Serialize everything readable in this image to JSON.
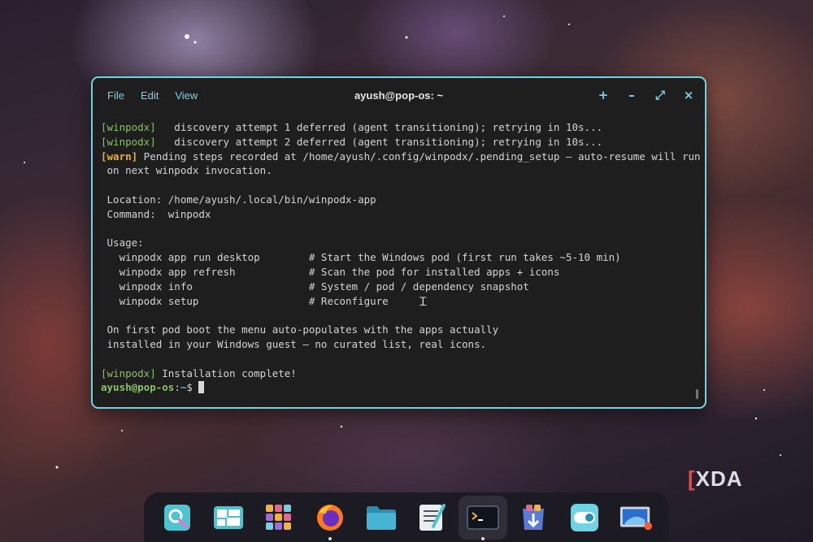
{
  "window": {
    "title": "ayush@pop-os: ~",
    "menu": [
      "File",
      "Edit",
      "View"
    ],
    "controls": {
      "new_tab": "+",
      "minimize": "–",
      "maximize": "⤢",
      "close": "×"
    }
  },
  "terminal": {
    "line1_tag": "[winpodx]",
    "line1_text": "   discovery attempt 1 deferred (agent transitioning); retrying in 10s...",
    "line2_tag": "[winpodx]",
    "line2_text": "   discovery attempt 2 deferred (agent transitioning); retrying in 10s...",
    "warn_tag": "[warn]",
    "warn_text": " Pending steps recorded at /home/ayush/.config/winpodx/.pending_setup — auto-resume will run",
    "warn_cont": " on next winpodx invocation.",
    "location": " Location: /home/ayush/.local/bin/winpodx-app",
    "command": " Command:  winpodx",
    "usage": " Usage:",
    "usage_rows": [
      "   winpodx app run desktop        # Start the Windows pod (first run takes ~5-10 min)",
      "   winpodx app refresh            # Scan the pod for installed apps + icons",
      "   winpodx info                   # System / pod / dependency snapshot",
      "   winpodx setup                  # Reconfigure"
    ],
    "note1": " On first pod boot the menu auto-populates with the apps actually",
    "note2": " installed in your Windows guest — no curated list, real icons.",
    "done_tag": "[winpodx]",
    "done_text": " Installation complete!",
    "prompt_user": "ayush@pop-os",
    "prompt_sep": ":",
    "prompt_path": "~",
    "prompt_symbol": "$ "
  },
  "watermark": {
    "bracket": "[",
    "text": "XDA"
  },
  "dock": [
    {
      "name": "launcher",
      "icon": "search-launcher-icon"
    },
    {
      "name": "workspaces",
      "icon": "workspaces-icon"
    },
    {
      "name": "app-library",
      "icon": "app-grid-icon"
    },
    {
      "name": "firefox",
      "icon": "firefox-icon",
      "running": true
    },
    {
      "name": "files",
      "icon": "folder-icon"
    },
    {
      "name": "text-editor",
      "icon": "text-editor-icon"
    },
    {
      "name": "terminal",
      "icon": "terminal-icon",
      "active": true,
      "running": true
    },
    {
      "name": "store",
      "icon": "app-store-icon"
    },
    {
      "name": "settings",
      "icon": "toggle-settings-icon"
    },
    {
      "name": "remote-desktop",
      "icon": "windows-vm-icon"
    }
  ],
  "colors": {
    "accent": "#6fd3e3",
    "tag": "#8fbf6a",
    "warn": "#e2b040",
    "terminal_bg": "#1e1e1e"
  }
}
